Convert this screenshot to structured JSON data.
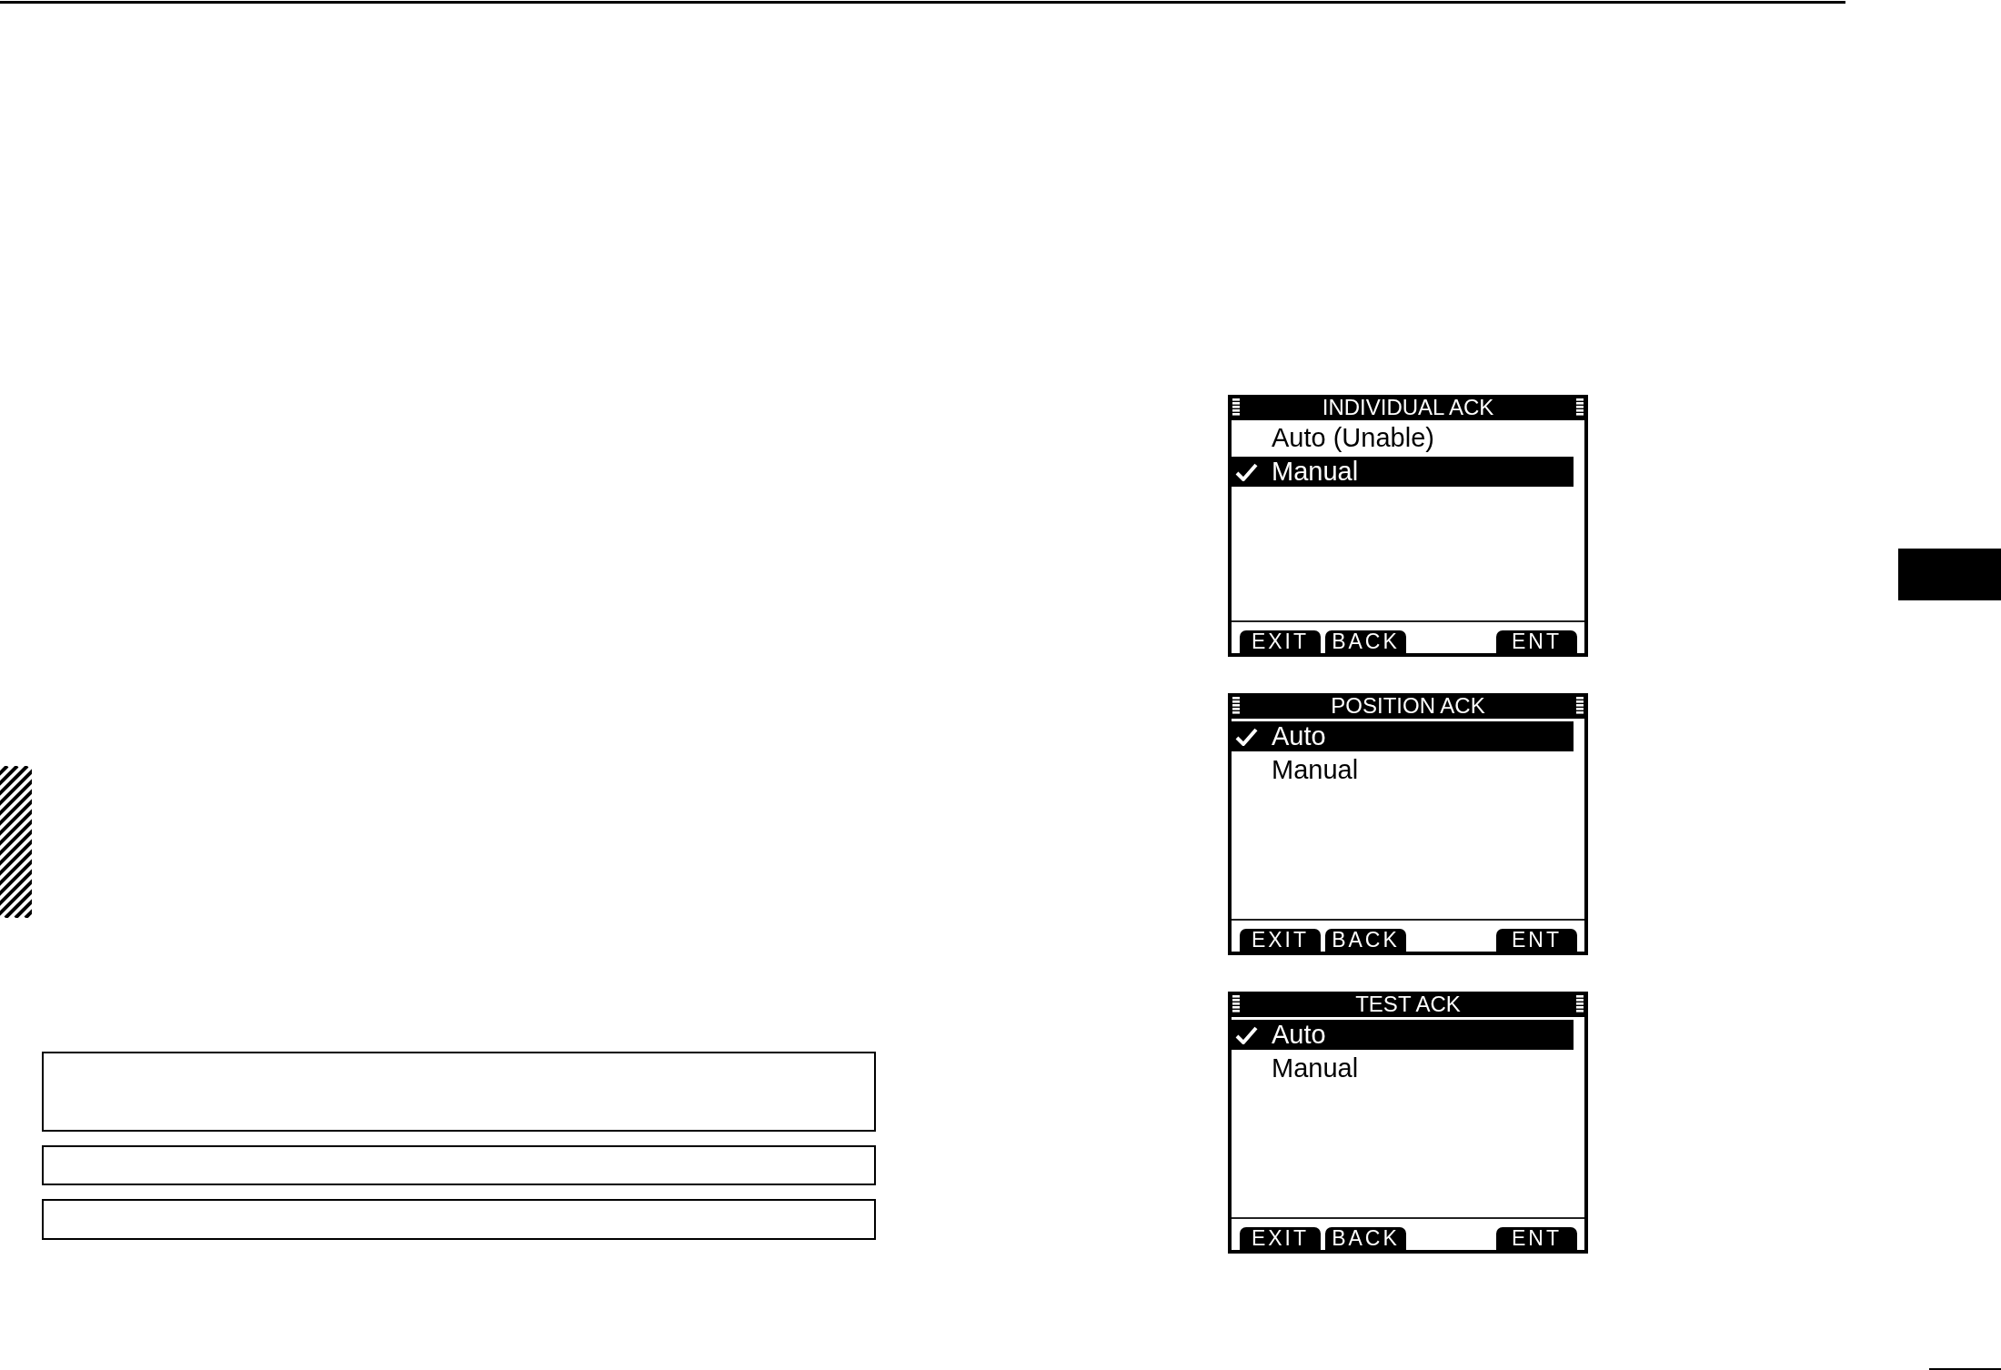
{
  "screens": [
    {
      "title": "INDIVIDUAL ACK",
      "options": [
        {
          "label": "Auto (Unable)",
          "selected": false
        },
        {
          "label": "Manual",
          "selected": true
        }
      ],
      "softkeys": {
        "left": [
          "EXIT",
          "BACK"
        ],
        "right": [
          "ENT"
        ]
      }
    },
    {
      "title": "POSITION ACK",
      "options": [
        {
          "label": "Auto",
          "selected": true
        },
        {
          "label": "Manual",
          "selected": false
        }
      ],
      "softkeys": {
        "left": [
          "EXIT",
          "BACK"
        ],
        "right": [
          "ENT"
        ]
      }
    },
    {
      "title": "TEST ACK",
      "options": [
        {
          "label": "Auto",
          "selected": true
        },
        {
          "label": "Manual",
          "selected": false
        }
      ],
      "softkeys": {
        "left": [
          "EXIT",
          "BACK"
        ],
        "right": [
          "ENT"
        ]
      }
    }
  ]
}
